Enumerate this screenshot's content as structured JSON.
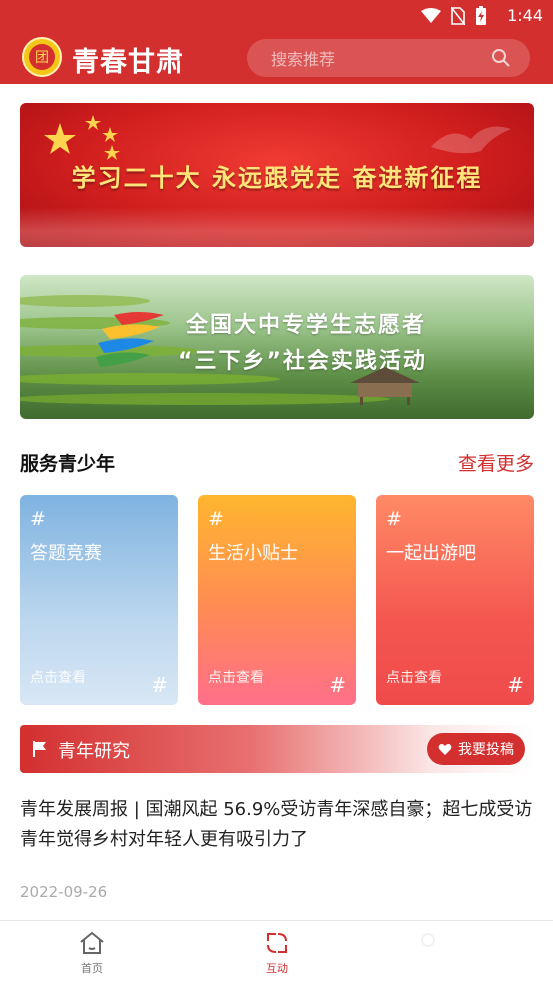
{
  "status": {
    "time": "1:44"
  },
  "header": {
    "app_title": "青春甘肃",
    "logo_char": "团",
    "logo_icon": "cyl-emblem-icon"
  },
  "search": {
    "placeholder": "搜索推荐",
    "icon": "search-icon"
  },
  "banners": [
    {
      "text": "学习二十大 永远跟党走 奋进新征程"
    },
    {
      "line1": "全国大中专学生志愿者",
      "line2": "“三下乡”社会实践活动"
    }
  ],
  "service": {
    "title": "服务青少年",
    "more_label": "查看更多",
    "cards": [
      {
        "hash": "#",
        "title": "答题竞赛",
        "cta": "点击查看",
        "hash2": "#"
      },
      {
        "hash": "#",
        "title": "生活小贴士",
        "cta": "点击查看",
        "hash2": "#"
      },
      {
        "hash": "#",
        "title": "一起出游吧",
        "cta": "点击查看",
        "hash2": "#"
      }
    ]
  },
  "research": {
    "label": "青年研究",
    "submit_label": "我要投稿",
    "article_title": "青年发展周报 | 国潮风起 56.9%受访青年深感自豪；超七成受访青年觉得乡村对年轻人更有吸引力了",
    "article_date": "2022-09-26"
  },
  "bottom_nav": [
    {
      "label": "首页",
      "icon": "home-icon"
    },
    {
      "label": "互动",
      "icon": "interact-icon"
    },
    {
      "label": "",
      "icon": "faded-icon"
    }
  ],
  "colors": {
    "brand_red": "#d32f2f",
    "card_blue": "#7fb3e0",
    "card_orange": "#ffb62e",
    "card_red": "#f4564f"
  }
}
